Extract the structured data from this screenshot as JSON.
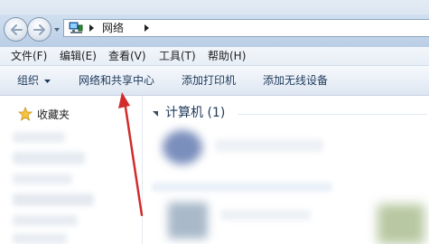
{
  "address_bar": {
    "location_label": "网络",
    "folder_icon": "network-folder-icon"
  },
  "menu": {
    "items": [
      "文件(F)",
      "编辑(E)",
      "查看(V)",
      "工具(T)",
      "帮助(H)"
    ]
  },
  "command_bar": {
    "organize": "组织",
    "network_center": "网络和共享中心",
    "add_printer": "添加打印机",
    "add_wireless": "添加无线设备"
  },
  "nav_pane": {
    "favorites_label": "收藏夹",
    "favorites_icon": "star-icon"
  },
  "content": {
    "group_label": "计算机 (1)"
  },
  "annotation": {
    "arrow_color": "#d22b2b"
  },
  "colors": {
    "accent": "#1e395b"
  }
}
